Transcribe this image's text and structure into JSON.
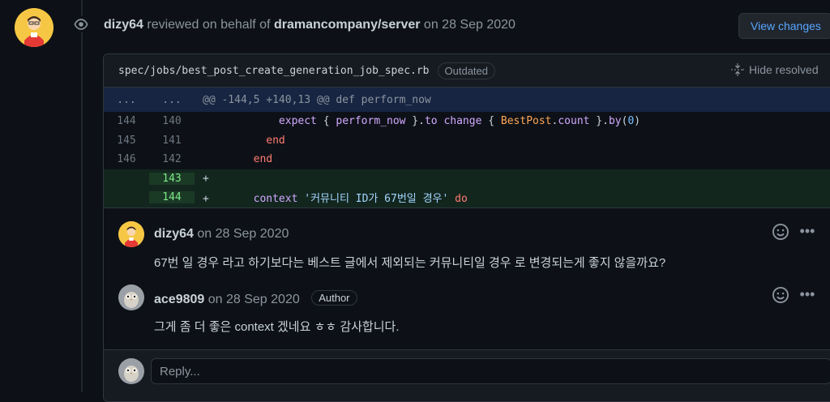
{
  "header": {
    "reviewer": "dizy64",
    "action_text": "reviewed on behalf of",
    "org_repo": "dramancompany/server",
    "date_text": "on 28 Sep 2020",
    "view_changes_label": "View changes"
  },
  "file": {
    "path": "spec/jobs/best_post_create_generation_job_spec.rb",
    "badge": "Outdated",
    "hide_resolved_label": "Hide resolved"
  },
  "diff": {
    "hunk": {
      "old": "...",
      "new": "...",
      "text": "@@ -144,5 +140,13 @@ def perform_now"
    },
    "lines": [
      {
        "old": "144",
        "new": "140",
        "type": "context"
      },
      {
        "old": "145",
        "new": "141",
        "type": "context",
        "code": "          end"
      },
      {
        "old": "146",
        "new": "142",
        "type": "context",
        "code": "        end"
      },
      {
        "old": "",
        "new": "143",
        "type": "add",
        "code": "+"
      },
      {
        "old": "",
        "new": "144",
        "type": "add"
      }
    ],
    "line1_tokens": {
      "indent": "+           ",
      "expect": "expect",
      "brace_open": " { ",
      "perform_now": "perform_now",
      "brace_close": " }.",
      "to": "to",
      "space1": " ",
      "change": "change",
      "brace_open2": " { ",
      "BestPost": "BestPost",
      "dot": ".",
      "count": "count",
      "brace_close2": " }.",
      "by": "by",
      "paren_open": "(",
      "zero": "0",
      "paren_close": ")"
    },
    "line5_tokens": {
      "prefix": "+       ",
      "context": "context",
      "space": " ",
      "string": "'커뮤니티 ID가 67번일 경우'",
      "space2": " ",
      "do": "do"
    }
  },
  "comments": [
    {
      "author": "dizy64",
      "date": "on 28 Sep 2020",
      "body": "67번 일 경우 라고 하기보다는 베스트 글에서 제외되는 커뮤니티일 경우 로 변경되는게 좋지 않을까요?"
    },
    {
      "author": "ace9809",
      "date": "on 28 Sep 2020",
      "badge": "Author",
      "body": "그게 좀 더 좋은 context 겠네요 ㅎㅎ 감사합니다."
    }
  ],
  "reply": {
    "placeholder": "Reply..."
  },
  "icons": {
    "eye": "eye-icon",
    "hide_resolved": "fold-icon",
    "smiley": "smiley-icon",
    "more": "kebab-horizontal-icon"
  },
  "colors": {
    "background": "#0d1117",
    "accent_link": "#58a6ff",
    "addition_bg": "#12261e",
    "hunk_bg": "#172542"
  }
}
